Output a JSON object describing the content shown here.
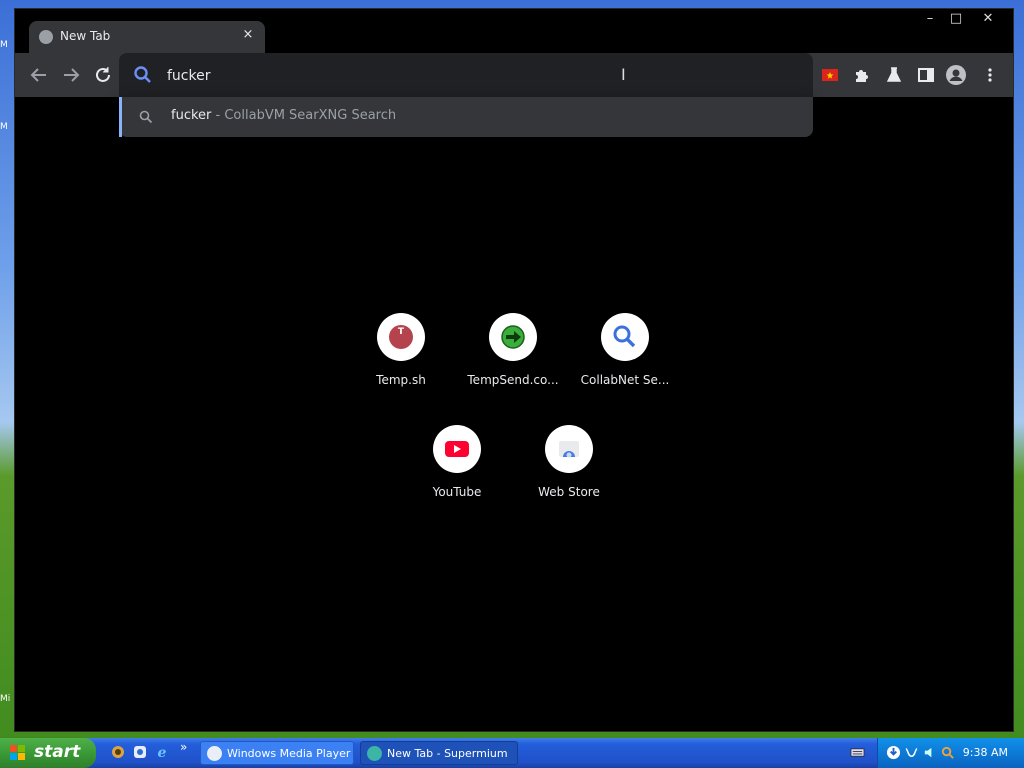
{
  "browser": {
    "tab": {
      "title": "New Tab",
      "close_icon": "×"
    },
    "window_controls": {
      "minimize": "–",
      "maximize": "□",
      "close": "✕"
    },
    "omnibox": {
      "value": "fucker"
    },
    "suggestion": {
      "query": "fucker",
      "separator": " - ",
      "engine": "CollabVM SearXNG Search"
    }
  },
  "shortcuts": [
    {
      "label": "Temp.sh",
      "icon": "temp-sh-icon"
    },
    {
      "label": "TempSend.co...",
      "icon": "tempsend-icon"
    },
    {
      "label": "CollabNet Se...",
      "icon": "search-icon"
    },
    {
      "label": "YouTube",
      "icon": "youtube-icon"
    },
    {
      "label": "Web Store",
      "icon": "web-store-icon"
    }
  ],
  "taskbar": {
    "start_label": "start",
    "tasks": [
      {
        "label": "Windows Media Player"
      },
      {
        "label": "New Tab - Supermium"
      }
    ],
    "clock": "9:38 AM",
    "overflow": "»"
  },
  "colors": {
    "accent": "#8ab4f8",
    "toolbar": "#35363a",
    "omnibox": "#202124",
    "start_green": "#3a9a36",
    "taskbar_blue": "#245edb"
  }
}
